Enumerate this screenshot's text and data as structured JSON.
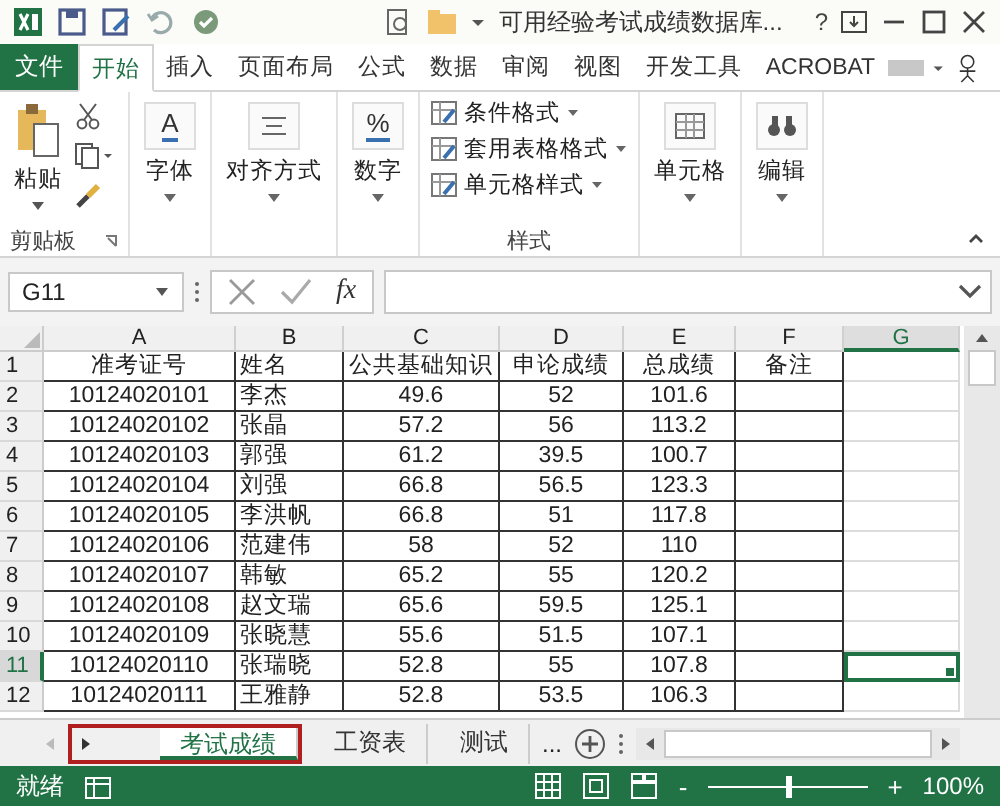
{
  "title_bar": {
    "title": "可用经验考试成绩数据库...",
    "help": "?"
  },
  "ribbon_tabs": [
    {
      "label": "文件",
      "kind": "file"
    },
    {
      "label": "开始",
      "kind": "tab",
      "selected": true
    },
    {
      "label": "插入",
      "kind": "tab",
      "selected": false
    },
    {
      "label": "页面布局",
      "kind": "tab",
      "selected": false
    },
    {
      "label": "公式",
      "kind": "tab",
      "selected": false
    },
    {
      "label": "数据",
      "kind": "tab",
      "selected": false
    },
    {
      "label": "审阅",
      "kind": "tab",
      "selected": false
    },
    {
      "label": "视图",
      "kind": "tab",
      "selected": false
    },
    {
      "label": "开发工具",
      "kind": "tab",
      "selected": false
    },
    {
      "label": "ACROBAT",
      "kind": "tab",
      "selected": false
    }
  ],
  "ribbon_groups": [
    {
      "kind": "clipboard",
      "paste": "粘贴",
      "label": "剪贴板"
    },
    {
      "kind": "big",
      "symbol": "A",
      "label": "字体"
    },
    {
      "kind": "big",
      "label": "对齐方式"
    },
    {
      "kind": "big",
      "symbol": "%",
      "label": "数字"
    },
    {
      "kind": "styles",
      "items": [
        "条件格式",
        "套用表格格式",
        "单元格样式"
      ],
      "label": "样式"
    },
    {
      "kind": "big",
      "label": "单元格"
    },
    {
      "kind": "big",
      "label": "编辑"
    }
  ],
  "formula_bar": {
    "name_box": "G11",
    "fx": "fx"
  },
  "columns": [
    {
      "label": "A",
      "selected": false
    },
    {
      "label": "B",
      "selected": false
    },
    {
      "label": "C",
      "selected": false
    },
    {
      "label": "D",
      "selected": false
    },
    {
      "label": "E",
      "selected": false
    },
    {
      "label": "F",
      "selected": false
    },
    {
      "label": "G",
      "selected": true
    }
  ],
  "rows": [
    {
      "number": "1",
      "selected": false,
      "cells": [
        "准考证号",
        "姓名",
        "公共基础知识",
        "申论成绩",
        "总成绩",
        "备注"
      ]
    },
    {
      "number": "2",
      "selected": false,
      "cells": [
        "10124020101",
        "李杰",
        "49.6",
        "52",
        "101.6"
      ]
    },
    {
      "number": "3",
      "selected": false,
      "cells": [
        "10124020102",
        "张晶",
        "57.2",
        "56",
        "113.2"
      ]
    },
    {
      "number": "4",
      "selected": false,
      "cells": [
        "10124020103",
        "郭强",
        "61.2",
        "39.5",
        "100.7"
      ]
    },
    {
      "number": "5",
      "selected": false,
      "cells": [
        "10124020104",
        "刘强",
        "66.8",
        "56.5",
        "123.3"
      ]
    },
    {
      "number": "6",
      "selected": false,
      "cells": [
        "10124020105",
        "李洪帆",
        "66.8",
        "51",
        "117.8"
      ]
    },
    {
      "number": "7",
      "selected": false,
      "cells": [
        "10124020106",
        "范建伟",
        "58",
        "52",
        "110"
      ]
    },
    {
      "number": "8",
      "selected": false,
      "cells": [
        "10124020107",
        "韩敏",
        "65.2",
        "55",
        "120.2"
      ]
    },
    {
      "number": "9",
      "selected": false,
      "cells": [
        "10124020108",
        "赵文瑞",
        "65.6",
        "59.5",
        "125.1"
      ]
    },
    {
      "number": "10",
      "selected": false,
      "cells": [
        "10124020109",
        "张晓慧",
        "55.6",
        "51.5",
        "107.1"
      ]
    },
    {
      "number": "11",
      "selected": true,
      "cells": [
        "10124020110",
        "张瑞晓",
        "52.8",
        "55",
        "107.8"
      ]
    },
    {
      "number": "12",
      "selected": false,
      "cells": [
        "10124020111",
        "王雅静",
        "52.8",
        "53.5",
        "106.3"
      ]
    }
  ],
  "sheet_tabs": [
    {
      "label": "考试成绩",
      "selected": true
    },
    {
      "label": "工资表",
      "selected": false
    },
    {
      "label": "测试",
      "selected": false
    }
  ],
  "sheet_more": "...",
  "status_bar": {
    "text": "就绪",
    "zoom_out": "-",
    "zoom_in": "+",
    "level": 0.5,
    "zoom": "100%"
  }
}
